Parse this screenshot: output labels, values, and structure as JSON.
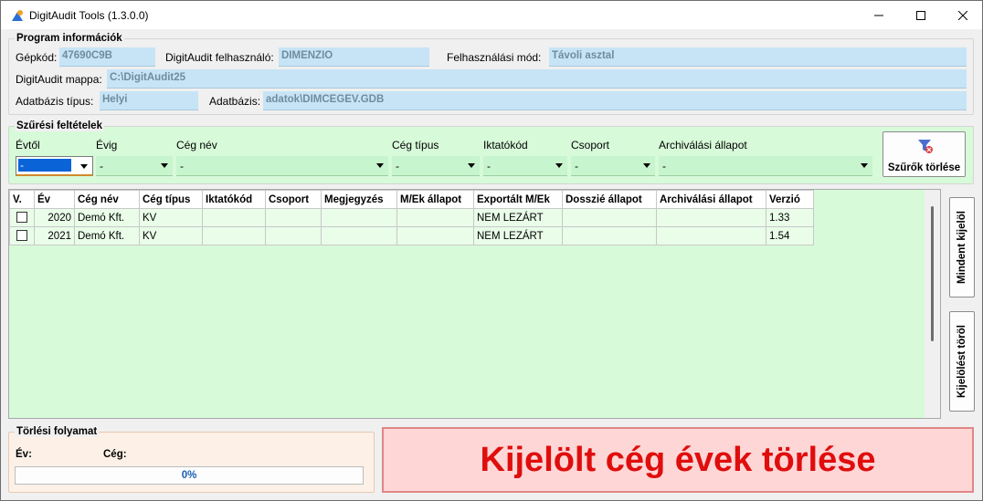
{
  "window": {
    "title": "DigitAudit Tools (1.3.0.0)"
  },
  "program_info": {
    "legend": "Program információk",
    "gepkod_label": "Gépkód:",
    "gepkod_value": "47690C9B",
    "felhasznalo_label": "DigitAudit felhasználó:",
    "felhasznalo_value": "DIMENZIO",
    "mod_label": "Felhasználási mód:",
    "mod_value": "Távoli asztal",
    "mappa_label": "DigitAudit mappa:",
    "mappa_value": "C:\\DigitAudit25",
    "db_tipus_label": "Adatbázis típus:",
    "db_tipus_value": "Helyi",
    "db_label": "Adatbázis:",
    "db_value": "adatok\\DIMCEGEV.GDB"
  },
  "filters": {
    "legend": "Szűrési feltételek",
    "evtol_label": "Évtől",
    "evtol_value": "-",
    "evig_label": "Évig",
    "evig_value": "-",
    "cegnev_label": "Cég név",
    "cegnev_value": "-",
    "cegtipus_label": "Cég típus",
    "cegtipus_value": "-",
    "iktato_label": "Iktatókód",
    "iktato_value": "-",
    "csoport_label": "Csoport",
    "csoport_value": "-",
    "archiv_label": "Archiválási állapot",
    "archiv_value": "-",
    "clear_label": "Szűrők törlése",
    "clear_icon": "filter-clear-icon"
  },
  "table": {
    "columns": [
      "V.",
      "Év",
      "Cég név",
      "Cég típus",
      "Iktatókód",
      "Csoport",
      "Megjegyzés",
      "M/Ek állapot",
      "Exportált M/Ek",
      "Dosszié állapot",
      "Archiválási állapot",
      "Verzió"
    ],
    "rows": [
      {
        "checked": false,
        "ev": "2020",
        "cegnev": "Demó Kft.",
        "cegtipus": "KV",
        "iktato": "",
        "csoport": "",
        "megjegyzes": "",
        "mek": "",
        "exportalt": "NEM LEZÁRT",
        "dosszie": "",
        "archiv": "",
        "verzio": "1.33"
      },
      {
        "checked": false,
        "ev": "2021",
        "cegnev": "Demó Kft.",
        "cegtipus": "KV",
        "iktato": "",
        "csoport": "",
        "megjegyzes": "",
        "mek": "",
        "exportalt": "NEM LEZÁRT",
        "dosszie": "",
        "archiv": "",
        "verzio": "1.54"
      }
    ]
  },
  "side_buttons": {
    "select_all": "Mindent kijelöl",
    "clear_selection": "Kijelölést töröl"
  },
  "progress": {
    "legend": "Törlési folyamat",
    "ev_label": "Év:",
    "ceg_label": "Cég:",
    "percent": 0,
    "percent_text": "0%"
  },
  "delete_button": {
    "label": "Kijelölt cég évek törlése"
  },
  "colors": {
    "accent": "#0a64d8",
    "danger": "#e00d0d",
    "grid_bg": "#d7fad9"
  }
}
